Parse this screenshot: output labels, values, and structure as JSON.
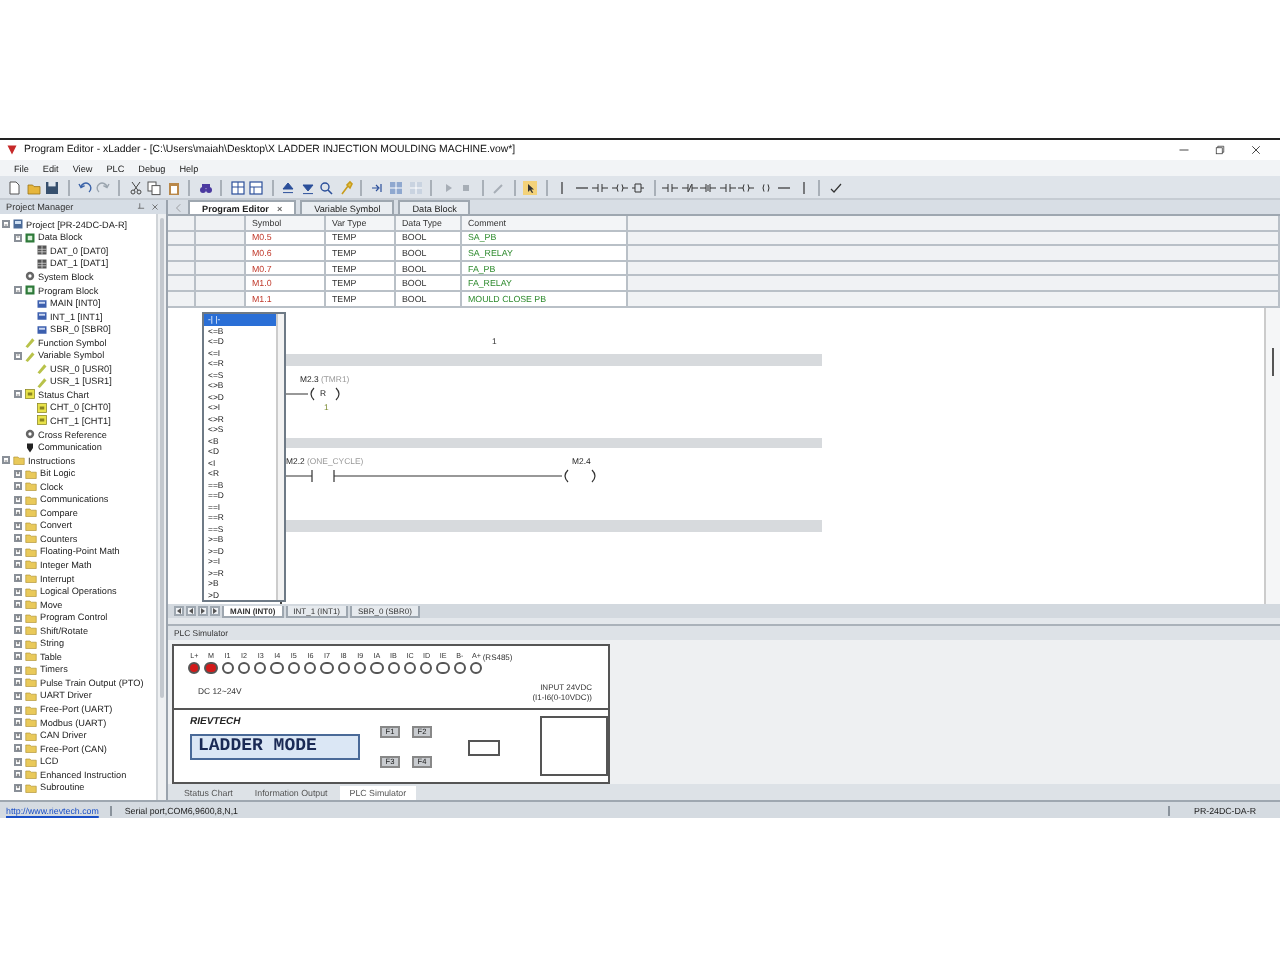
{
  "window": {
    "title": "Program Editor - xLadder - [C:\\Users\\maiah\\Desktop\\X LADDER INJECTION MOULDING MACHINE.vow*]"
  },
  "menu": [
    "File",
    "Edit",
    "View",
    "PLC",
    "Debug",
    "Help"
  ],
  "project_manager": {
    "title": "Project Manager",
    "tree": [
      {
        "label": "Project [PR-24DC-DA-R]",
        "kind": "project",
        "expanded": true,
        "children": [
          {
            "label": "Data Block",
            "kind": "block",
            "expanded": true,
            "children": [
              {
                "label": "DAT_0 [DAT0]",
                "kind": "table"
              },
              {
                "label": "DAT_1 [DAT1]",
                "kind": "table"
              }
            ]
          },
          {
            "label": "System Block",
            "kind": "gear"
          },
          {
            "label": "Program Block",
            "kind": "block",
            "expanded": true,
            "children": [
              {
                "label": "MAIN [INT0]",
                "kind": "program"
              },
              {
                "label": "INT_1 [INT1]",
                "kind": "program"
              },
              {
                "label": "SBR_0 [SBR0]",
                "kind": "program"
              }
            ]
          },
          {
            "label": "Function Symbol",
            "kind": "symbol"
          },
          {
            "label": "Variable Symbol",
            "kind": "symbol",
            "expanded": true,
            "children": [
              {
                "label": "USR_0 [USR0]",
                "kind": "symbol"
              },
              {
                "label": "USR_1 [USR1]",
                "kind": "symbol"
              }
            ]
          },
          {
            "label": "Status Chart",
            "kind": "chart",
            "expanded": true,
            "children": [
              {
                "label": "CHT_0 [CHT0]",
                "kind": "chart"
              },
              {
                "label": "CHT_1 [CHT1]",
                "kind": "chart"
              }
            ]
          },
          {
            "label": "Cross Reference",
            "kind": "gear"
          },
          {
            "label": "Communication",
            "kind": "plug"
          }
        ]
      },
      {
        "label": "Instructions",
        "kind": "folder",
        "expanded": true,
        "children": [
          {
            "label": "Bit Logic",
            "kind": "folder",
            "expanded": false
          },
          {
            "label": "Clock",
            "kind": "folder",
            "expanded": false
          },
          {
            "label": "Communications",
            "kind": "folder",
            "expanded": false
          },
          {
            "label": "Compare",
            "kind": "folder",
            "expanded": false
          },
          {
            "label": "Convert",
            "kind": "folder",
            "expanded": false
          },
          {
            "label": "Counters",
            "kind": "folder",
            "expanded": false
          },
          {
            "label": "Floating-Point Math",
            "kind": "folder",
            "expanded": false
          },
          {
            "label": "Integer Math",
            "kind": "folder",
            "expanded": false
          },
          {
            "label": "Interrupt",
            "kind": "folder",
            "expanded": false
          },
          {
            "label": "Logical Operations",
            "kind": "folder",
            "expanded": false
          },
          {
            "label": "Move",
            "kind": "folder",
            "expanded": false
          },
          {
            "label": "Program Control",
            "kind": "folder",
            "expanded": false
          },
          {
            "label": "Shift/Rotate",
            "kind": "folder",
            "expanded": false
          },
          {
            "label": "String",
            "kind": "folder",
            "expanded": false
          },
          {
            "label": "Table",
            "kind": "folder",
            "expanded": false
          },
          {
            "label": "Timers",
            "kind": "folder",
            "expanded": false
          },
          {
            "label": "Pulse Train Output (PTO)",
            "kind": "folder",
            "expanded": false
          },
          {
            "label": "UART Driver",
            "kind": "folder",
            "expanded": false
          },
          {
            "label": "Free-Port (UART)",
            "kind": "folder",
            "expanded": false
          },
          {
            "label": "Modbus (UART)",
            "kind": "folder",
            "expanded": false
          },
          {
            "label": "CAN Driver",
            "kind": "folder",
            "expanded": false
          },
          {
            "label": "Free-Port (CAN)",
            "kind": "folder",
            "expanded": false
          },
          {
            "label": "LCD",
            "kind": "folder",
            "expanded": false
          },
          {
            "label": "Enhanced Instruction",
            "kind": "folder",
            "expanded": false
          },
          {
            "label": "Subroutine",
            "kind": "folder",
            "expanded": false
          }
        ]
      }
    ]
  },
  "editor_tabs": [
    {
      "label": "Program Editor",
      "selected": true,
      "close": "×"
    },
    {
      "label": "Variable Symbol",
      "selected": false
    },
    {
      "label": "Data Block",
      "selected": false
    }
  ],
  "symbol_table": {
    "columns": [
      "Symbol",
      "Var Type",
      "Data Type",
      "Comment"
    ],
    "rows": [
      {
        "symbol": "M0.5",
        "var_type": "TEMP",
        "data_type": "BOOL",
        "comment": "SA_PB"
      },
      {
        "symbol": "M0.6",
        "var_type": "TEMP",
        "data_type": "BOOL",
        "comment": "SA_RELAY"
      },
      {
        "symbol": "M0.7",
        "var_type": "TEMP",
        "data_type": "BOOL",
        "comment": "FA_PB"
      },
      {
        "symbol": "M1.0",
        "var_type": "TEMP",
        "data_type": "BOOL",
        "comment": "FA_RELAY"
      },
      {
        "symbol": "M1.1",
        "var_type": "TEMP",
        "data_type": "BOOL",
        "comment": "MOULD CLOSE PB"
      }
    ]
  },
  "ladder": {
    "top_value": "1",
    "rungs": [
      {
        "kind": "coil",
        "address": "M2.3",
        "symbol": "(TMR1)",
        "letter": "R",
        "value": "1"
      },
      {
        "kind": "contact_coil",
        "address": "M2.2",
        "symbol": "(ONE_CYCLE)",
        "coil_address": "M2.4"
      },
      {
        "kind": "empty"
      }
    ]
  },
  "instruction_list": {
    "items": [
      {
        "label": "-| |-",
        "selected": true
      },
      {
        "label": "<=B",
        "selected": false
      },
      {
        "label": "<=D",
        "selected": false
      },
      {
        "label": "<=I",
        "selected": false
      },
      {
        "label": "<=R",
        "selected": false
      },
      {
        "label": "<=S",
        "selected": false
      },
      {
        "label": "<>B",
        "selected": false
      },
      {
        "label": "<>D",
        "selected": false
      },
      {
        "label": "<>I",
        "selected": false
      },
      {
        "label": "<>R",
        "selected": false
      },
      {
        "label": "<>S",
        "selected": false
      },
      {
        "label": "<B",
        "selected": false
      },
      {
        "label": "<D",
        "selected": false
      },
      {
        "label": "<I",
        "selected": false
      },
      {
        "label": "<R",
        "selected": false
      },
      {
        "label": "==B",
        "selected": false
      },
      {
        "label": "==D",
        "selected": false
      },
      {
        "label": "==I",
        "selected": false
      },
      {
        "label": "==R",
        "selected": false
      },
      {
        "label": "==S",
        "selected": false
      },
      {
        "label": ">=B",
        "selected": false
      },
      {
        "label": ">=D",
        "selected": false
      },
      {
        "label": ">=I",
        "selected": false
      },
      {
        "label": ">=R",
        "selected": false
      },
      {
        "label": ">B",
        "selected": false
      },
      {
        "label": ">D",
        "selected": false
      }
    ]
  },
  "program_tabs": [
    {
      "label": "MAIN (INT0)",
      "selected": true
    },
    {
      "label": "INT_1 (INT1)",
      "selected": false
    },
    {
      "label": "SBR_0 (SBR0)",
      "selected": false
    }
  ],
  "simulator": {
    "title": "PLC Simulator",
    "terminals": [
      {
        "label": "L+",
        "on": true
      },
      {
        "label": "M",
        "on": true
      },
      {
        "label": "I1",
        "on": false
      },
      {
        "label": "I2",
        "on": false
      },
      {
        "label": "I3",
        "on": false
      },
      {
        "label": "I4",
        "on": false
      },
      {
        "label": "I5",
        "on": false
      },
      {
        "label": "I6",
        "on": false
      },
      {
        "label": "I7",
        "on": false
      },
      {
        "label": "I8",
        "on": false
      },
      {
        "label": "I9",
        "on": false
      },
      {
        "label": "IA",
        "on": false
      },
      {
        "label": "IB",
        "on": false
      },
      {
        "label": "IC",
        "on": false
      },
      {
        "label": "ID",
        "on": false
      },
      {
        "label": "IE",
        "on": false
      },
      {
        "label": "B-",
        "on": false
      },
      {
        "label": "A+",
        "on": false
      }
    ],
    "rs485": "(RS485)",
    "supply": "DC 12~24V",
    "input_note": "INPUT 24VDC",
    "input_range": "(I1-I6(0-10VDC))",
    "brand": "RIEVTECH",
    "lcd": "LADDER MODE",
    "keys": [
      "F1",
      "F2",
      "F3",
      "F4"
    ]
  },
  "bottom_tabs": [
    {
      "label": "Status Chart",
      "selected": false
    },
    {
      "label": "Information Output",
      "selected": false
    },
    {
      "label": "PLC Simulator",
      "selected": true
    }
  ],
  "status_bar": {
    "link": "http://www.rievtech.com",
    "port": "Serial port,COM6,9600,8,N,1",
    "model": "PR-24DC-DA-R"
  }
}
